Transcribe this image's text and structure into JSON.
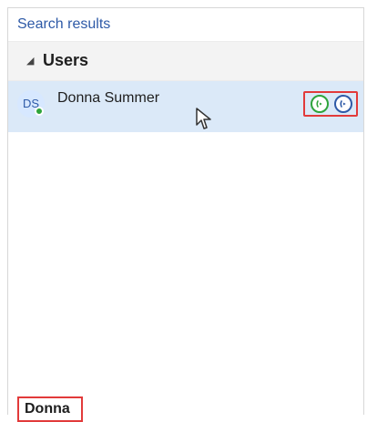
{
  "header": {
    "title": "Search results"
  },
  "group": {
    "caret_glyph": "◢",
    "label": "Users"
  },
  "result": {
    "initials": "DS",
    "name": "Donna Summer",
    "presence_color": "#2ea43b",
    "actions": {
      "video_icon": "video-call-icon",
      "audio_icon": "audio-call-icon"
    }
  },
  "search": {
    "value": "Donna"
  },
  "colors": {
    "accent_blue": "#2e5aa7",
    "accent_green": "#2ea43b",
    "highlight_red": "#e23a3a",
    "row_selected": "#dbe9f8"
  }
}
